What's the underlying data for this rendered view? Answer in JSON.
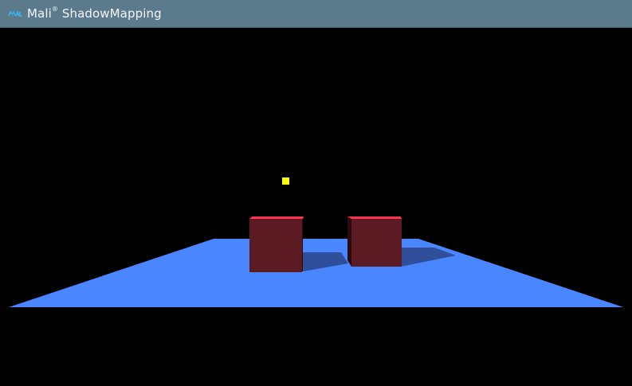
{
  "titlebar": {
    "app_name": "Mali",
    "registered_mark": "®",
    "title_rest": " ShadowMapping",
    "icon": "mali-logo-icon"
  },
  "scene": {
    "description_colors": {
      "background": "#000000",
      "plane": "#4a86ff",
      "shadow": "#2f4f9a",
      "cube_front": "#5c1a22",
      "cube_top": "#ff3050",
      "light_marker": "#ffff00"
    }
  }
}
